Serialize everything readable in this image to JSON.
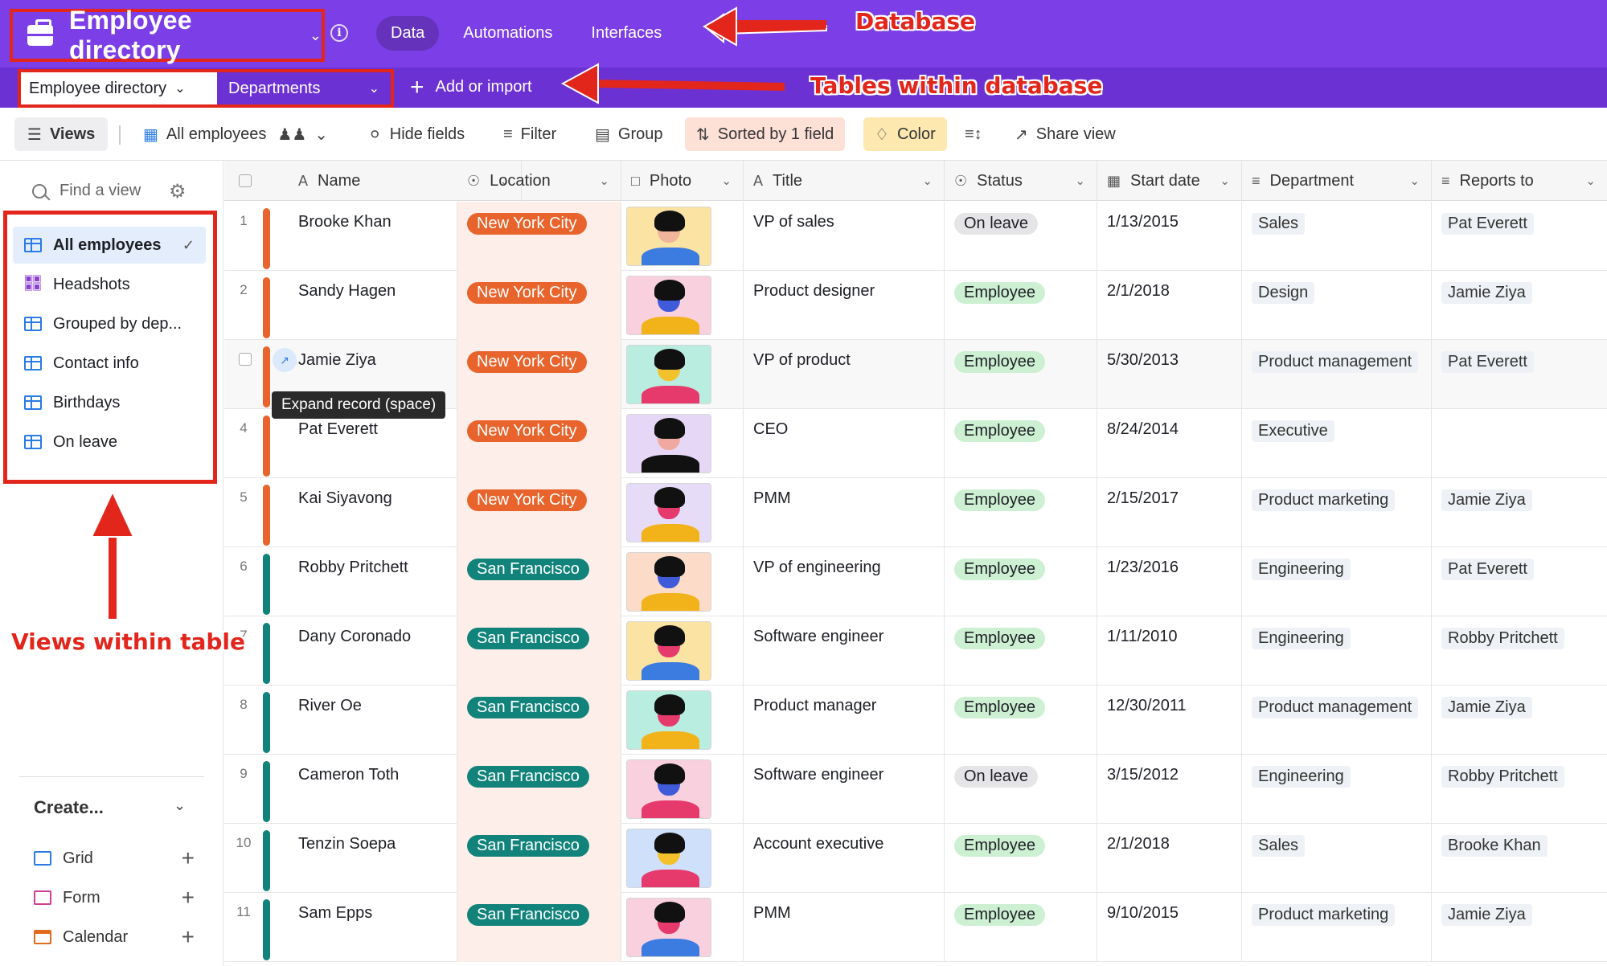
{
  "base": {
    "title": "Employee directory",
    "info_icon": "info-icon",
    "briefcase_icon": "briefcase-icon"
  },
  "top_nav": [
    {
      "label": "Data",
      "active": true
    },
    {
      "label": "Automations",
      "active": false
    },
    {
      "label": "Interfaces",
      "active": false
    }
  ],
  "tables": [
    {
      "label": "Employee directory",
      "active": true
    },
    {
      "label": "Departments",
      "active": false
    }
  ],
  "add_import_label": "Add or import",
  "toolbar": {
    "views_label": "Views",
    "current_view": "All employees",
    "hide_fields": "Hide fields",
    "filter": "Filter",
    "group": "Group",
    "sorted": "Sorted by 1 field",
    "color": "Color",
    "share_view": "Share view"
  },
  "sidebar": {
    "find_placeholder": "Find a view",
    "views": [
      {
        "label": "All employees",
        "icon": "grid-icon",
        "active": true
      },
      {
        "label": "Headshots",
        "icon": "gallery-icon",
        "active": false
      },
      {
        "label": "Grouped by dep...",
        "icon": "grid-icon",
        "active": false
      },
      {
        "label": "Contact info",
        "icon": "grid-icon",
        "active": false
      },
      {
        "label": "Birthdays",
        "icon": "grid-icon",
        "active": false
      },
      {
        "label": "On leave",
        "icon": "grid-icon",
        "active": false
      }
    ],
    "create_label": "Create...",
    "create_items": [
      {
        "label": "Grid",
        "icon": "grid-icon"
      },
      {
        "label": "Form",
        "icon": "form-icon"
      },
      {
        "label": "Calendar",
        "icon": "calendar-icon"
      }
    ]
  },
  "columns": {
    "name": "Name",
    "location": "Location",
    "photo": "Photo",
    "title": "Title",
    "status": "Status",
    "start_date": "Start date",
    "department": "Department",
    "reports_to": "Reports to"
  },
  "colors": {
    "brand_purple": "#7c3ee6",
    "nyc": "#e8642c",
    "sf": "#12837a",
    "employee_bg": "#cdefd2",
    "on_leave_bg": "#e5e5e7",
    "annotation_red": "#e2261c"
  },
  "rows": [
    {
      "num": "1",
      "name": "Brooke Khan",
      "location": "New York City",
      "title": "VP of sales",
      "status": "On leave",
      "start": "1/13/2015",
      "dept": "Sales",
      "reports": "Pat Everett",
      "photo_bg": "#fbe3a3",
      "skin": "#f0b59a",
      "shirt": "#3c7be0"
    },
    {
      "num": "2",
      "name": "Sandy Hagen",
      "location": "New York City",
      "title": "Product designer",
      "status": "Employee",
      "start": "2/1/2018",
      "dept": "Design",
      "reports": "Jamie Ziya",
      "photo_bg": "#f9d0de",
      "skin": "#3f5bd9",
      "shirt": "#f2b21a"
    },
    {
      "num": "",
      "name": "Jamie Ziya",
      "location": "New York City",
      "title": "VP of product",
      "status": "Employee",
      "start": "5/30/2013",
      "dept": "Product management",
      "reports": "Pat Everett",
      "photo_bg": "#b9ede0",
      "skin": "#f3c12c",
      "shirt": "#e63a6d"
    },
    {
      "num": "4",
      "name": "Pat Everett",
      "location": "New York City",
      "title": "CEO",
      "status": "Employee",
      "start": "8/24/2014",
      "dept": "Executive",
      "reports": "",
      "photo_bg": "#e6d7f6",
      "skin": "#f0a9a0",
      "shirt": "#111111"
    },
    {
      "num": "5",
      "name": "Kai Siyavong",
      "location": "New York City",
      "title": "PMM",
      "status": "Employee",
      "start": "2/15/2017",
      "dept": "Product marketing",
      "reports": "Jamie Ziya",
      "photo_bg": "#e6dcf7",
      "skin": "#e63a6d",
      "shirt": "#f2b21a"
    },
    {
      "num": "6",
      "name": "Robby Pritchett",
      "location": "San Francisco",
      "title": "VP of engineering",
      "status": "Employee",
      "start": "1/23/2016",
      "dept": "Engineering",
      "reports": "Pat Everett",
      "photo_bg": "#fcdcc8",
      "skin": "#3f5bd9",
      "shirt": "#f2b21a"
    },
    {
      "num": "7",
      "name": "Dany Coronado",
      "location": "San Francisco",
      "title": "Software engineer",
      "status": "Employee",
      "start": "1/11/2010",
      "dept": "Engineering",
      "reports": "Robby Pritchett",
      "photo_bg": "#fbe3a3",
      "skin": "#e63a6d",
      "shirt": "#3c7be0"
    },
    {
      "num": "8",
      "name": "River Oe",
      "location": "San Francisco",
      "title": "Product manager",
      "status": "Employee",
      "start": "12/30/2011",
      "dept": "Product management",
      "reports": "Jamie Ziya",
      "photo_bg": "#b9ede0",
      "skin": "#e63a6d",
      "shirt": "#f2b21a"
    },
    {
      "num": "9",
      "name": "Cameron Toth",
      "location": "San Francisco",
      "title": "Software engineer",
      "status": "On leave",
      "start": "3/15/2012",
      "dept": "Engineering",
      "reports": "Robby Pritchett",
      "photo_bg": "#f9d0de",
      "skin": "#3f5bd9",
      "shirt": "#e63a6d"
    },
    {
      "num": "10",
      "name": "Tenzin Soepa",
      "location": "San Francisco",
      "title": "Account executive",
      "status": "Employee",
      "start": "2/1/2018",
      "dept": "Sales",
      "reports": "Brooke Khan",
      "photo_bg": "#cfe0fa",
      "skin": "#f3c12c",
      "shirt": "#e63a6d"
    },
    {
      "num": "11",
      "name": "Sam Epps",
      "location": "San Francisco",
      "title": "PMM",
      "status": "Employee",
      "start": "9/10/2015",
      "dept": "Product marketing",
      "reports": "Jamie Ziya",
      "photo_bg": "#f9d0de",
      "skin": "#e63a6d",
      "shirt": "#3c7be0"
    }
  ],
  "tooltip": "Expand record (space)",
  "annotations": {
    "database": "Database",
    "tables": "Tables within database",
    "views": "Views within table"
  }
}
